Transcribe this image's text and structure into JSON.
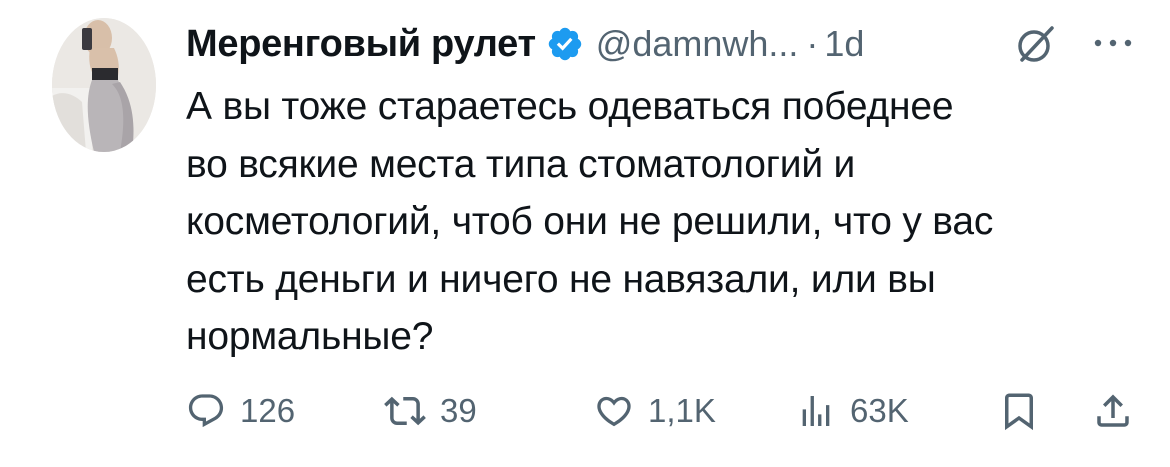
{
  "tweet": {
    "display_name": "Меренговый рулет",
    "handle": "@damnwh...",
    "separator": "·",
    "time": "1d",
    "text_lines": [
      "А вы тоже стараетесь одеваться победнее",
      "во всякие места типа стоматологий и",
      "косметологий, чтоб они не решили, что у вас",
      "есть деньги и ничего не навязали, или вы",
      "нормальные?"
    ],
    "icons": {
      "verified": "verified-badge-icon",
      "grok": "grok-icon",
      "more": "more-options-icon"
    }
  },
  "actions": {
    "reply": {
      "icon": "reply-icon",
      "count": "126"
    },
    "retweet": {
      "icon": "retweet-icon",
      "count": "39"
    },
    "like": {
      "icon": "heart-icon",
      "count": "1,1K"
    },
    "views": {
      "icon": "views-icon",
      "count": "63K"
    },
    "bookmark": {
      "icon": "bookmark-icon"
    },
    "share": {
      "icon": "share-icon"
    }
  },
  "colors": {
    "text": "#0f1419",
    "secondary": "#536471",
    "verified": "#1d9bf0",
    "background": "#ffffff"
  }
}
